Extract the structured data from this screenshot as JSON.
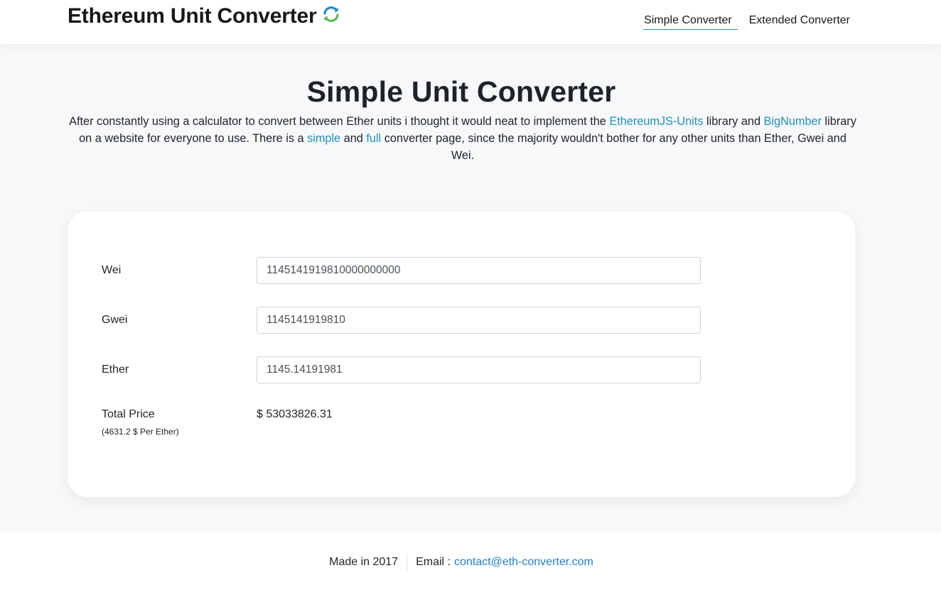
{
  "header": {
    "brand_title": "Ethereum Unit Converter",
    "brand_icon": "refresh-icon",
    "nav": {
      "simple": "Simple Converter",
      "extended": "Extended Converter"
    }
  },
  "main": {
    "title": "Simple Unit Converter",
    "intro": {
      "p1": "After constantly using a calculator to convert between Ether units i thought it would neat to implement the ",
      "link1": "EthereumJS-Units",
      "p2": " library and ",
      "link2": "BigNumber",
      "p3": " library on a website for everyone to use. There is a ",
      "link3": "simple",
      "p4": " and ",
      "link4": "full",
      "p5": " converter page, since the majority wouldn't bother for any other units than Ether, Gwei and Wei."
    },
    "converter": {
      "wei": {
        "label": "Wei",
        "value": "1145141919810000000000"
      },
      "gwei": {
        "label": "Gwei",
        "value": "1145141919810"
      },
      "ether": {
        "label": "Ether",
        "value": "1145.14191981"
      },
      "total": {
        "label": "Total Price",
        "value": "$ 53033826.31",
        "rate": "(4631.2 $ Per Ether)"
      }
    }
  },
  "footer": {
    "made": "Made in 2017",
    "email_label": "Email :",
    "email": "contact@eth-converter.com"
  },
  "colors": {
    "link": "#2291b8",
    "nav_underline": "#1a8fb0",
    "main_bg": "#f7f8fa",
    "icon_blue": "#2a8bbd",
    "icon_green": "#5cb85c"
  }
}
